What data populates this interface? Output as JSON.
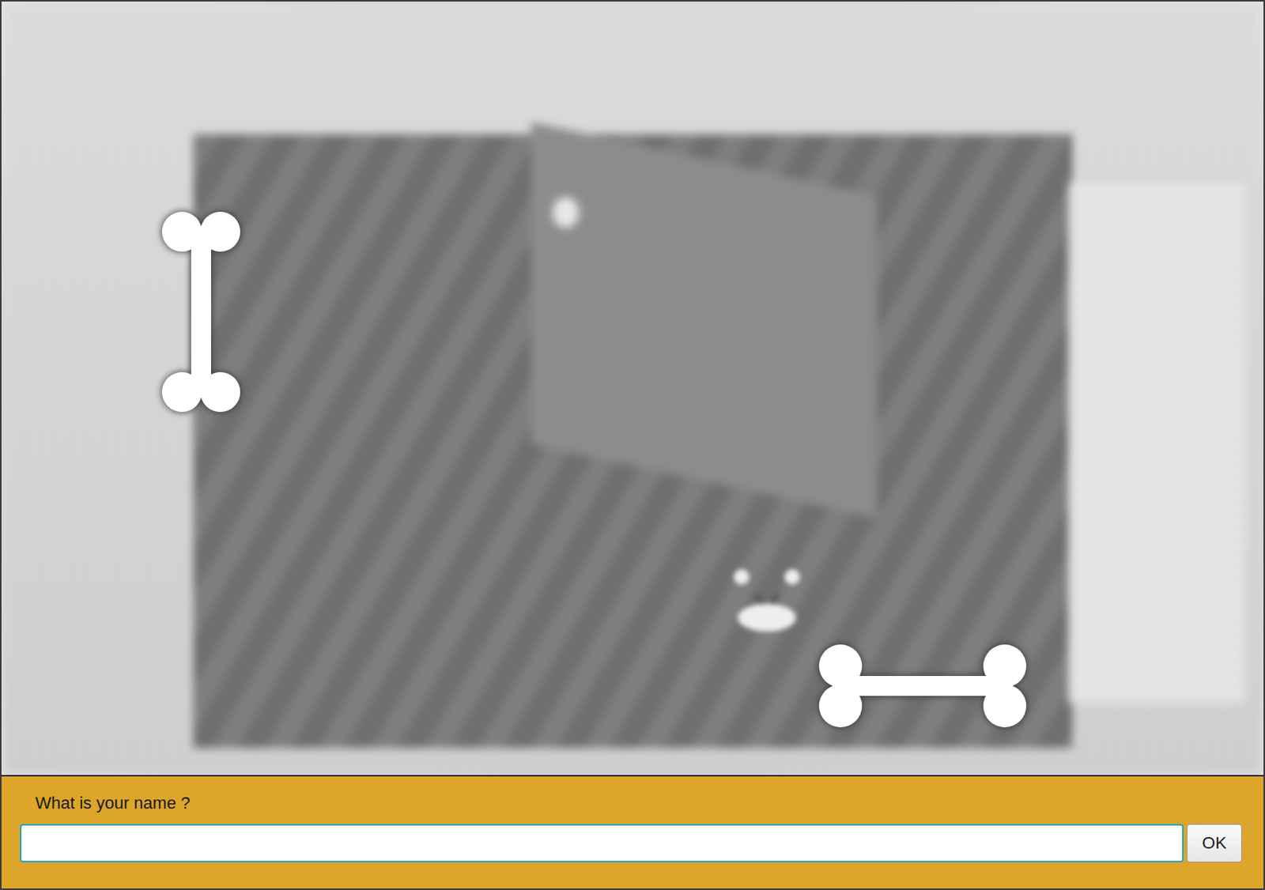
{
  "game": {
    "scene": "blurred-room"
  },
  "dialog": {
    "prompt": "What is your name ?",
    "input": {
      "value": "",
      "focused": true
    },
    "buttons": [
      "OK"
    ]
  }
}
